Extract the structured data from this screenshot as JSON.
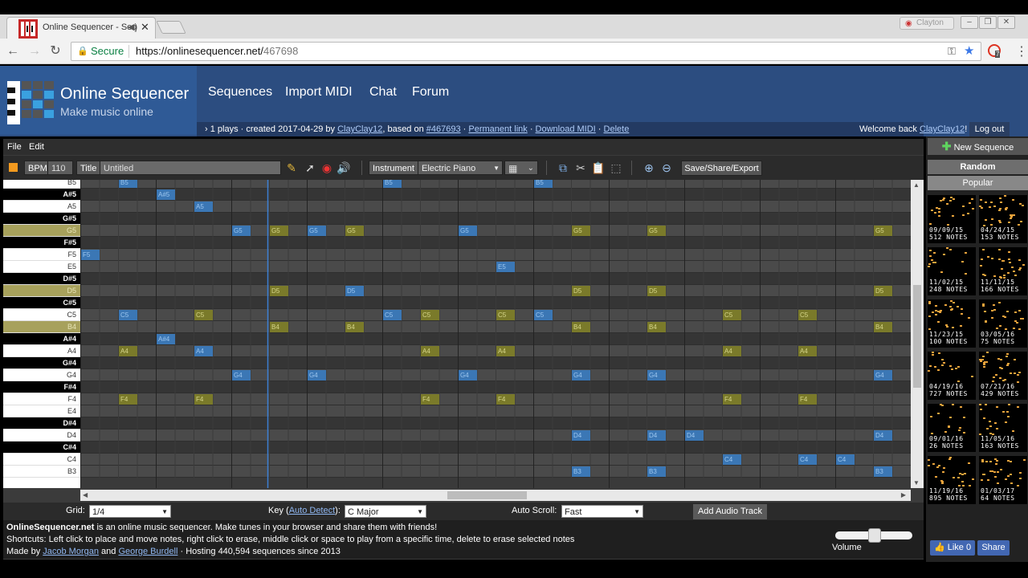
{
  "browser": {
    "tab_title": "Online Sequencer - Seq",
    "user_label": "Clayton",
    "secure_label": "Secure",
    "url_host": "https://onlinesequencer.net/",
    "url_path": "467698",
    "ext_badge": "7"
  },
  "site": {
    "title": "Online Sequencer",
    "subtitle": "Make music online",
    "nav": [
      "Sequences",
      "Import MIDI",
      "Chat",
      "Forum"
    ],
    "info": {
      "prefix": "› 1 plays · created 2017-04-29 by ",
      "author": "ClayClay12",
      "based_on_text": ", based on ",
      "based_on_link": "#467693",
      "sep1": " · ",
      "permanent": "Permanent link",
      "sep2": " · ",
      "download": "Download MIDI",
      "sep3": " · ",
      "delete": "Delete"
    },
    "welcome_text": "Welcome back ",
    "welcome_user": "ClayClay12",
    "welcome_suffix": "!",
    "logout": "Log out"
  },
  "app": {
    "menu": [
      "File",
      "Edit"
    ],
    "bpm_label": "BPM",
    "bpm_value": "110",
    "title_label": "Title",
    "title_value": "Untitled",
    "instrument_label": "Instrument",
    "instrument_value": "Electric Piano",
    "save_button": "Save/Share/Export",
    "colors": {
      "note_blue": "#3b77b5",
      "note_yellow": "#7a7a2a",
      "header_blue": "#2c4d80"
    }
  },
  "piano_keys": [
    {
      "label": "B5",
      "black": false,
      "hl": false
    },
    {
      "label": "A#5",
      "black": true,
      "hl": false
    },
    {
      "label": "A5",
      "black": false,
      "hl": false
    },
    {
      "label": "G#5",
      "black": true,
      "hl": false
    },
    {
      "label": "G5",
      "black": false,
      "hl": true
    },
    {
      "label": "F#5",
      "black": true,
      "hl": false
    },
    {
      "label": "F5",
      "black": false,
      "hl": false
    },
    {
      "label": "E5",
      "black": false,
      "hl": false
    },
    {
      "label": "D#5",
      "black": true,
      "hl": false
    },
    {
      "label": "D5",
      "black": false,
      "hl": true
    },
    {
      "label": "C#5",
      "black": true,
      "hl": false
    },
    {
      "label": "C5",
      "black": false,
      "hl": false
    },
    {
      "label": "B4",
      "black": false,
      "hl": true
    },
    {
      "label": "A#4",
      "black": true,
      "hl": false
    },
    {
      "label": "A4",
      "black": false,
      "hl": false
    },
    {
      "label": "G#4",
      "black": true,
      "hl": false
    },
    {
      "label": "G4",
      "black": false,
      "hl": false
    },
    {
      "label": "F#4",
      "black": true,
      "hl": false
    },
    {
      "label": "F4",
      "black": false,
      "hl": false
    },
    {
      "label": "E4",
      "black": false,
      "hl": false
    },
    {
      "label": "D#4",
      "black": true,
      "hl": false
    },
    {
      "label": "D4",
      "black": false,
      "hl": false
    },
    {
      "label": "C#4",
      "black": true,
      "hl": false
    },
    {
      "label": "C4",
      "black": false,
      "hl": false
    },
    {
      "label": "B3",
      "black": false,
      "hl": false
    }
  ],
  "notes": [
    {
      "n": "B5",
      "s": 2,
      "c": "b"
    },
    {
      "n": "B5",
      "s": 16,
      "c": "b"
    },
    {
      "n": "B5",
      "s": 24,
      "c": "b"
    },
    {
      "n": "A#5",
      "s": 4,
      "c": "b"
    },
    {
      "n": "A5",
      "s": 6,
      "c": "b"
    },
    {
      "n": "G5",
      "s": 8,
      "c": "b"
    },
    {
      "n": "G5",
      "s": 10,
      "c": "y"
    },
    {
      "n": "G5",
      "s": 12,
      "c": "b"
    },
    {
      "n": "G5",
      "s": 14,
      "c": "y"
    },
    {
      "n": "G5",
      "s": 20,
      "c": "b"
    },
    {
      "n": "G5",
      "s": 26,
      "c": "y"
    },
    {
      "n": "G5",
      "s": 30,
      "c": "y"
    },
    {
      "n": "G5",
      "s": 42,
      "c": "y"
    },
    {
      "n": "F5",
      "s": 0,
      "c": "b"
    },
    {
      "n": "E5",
      "s": 22,
      "c": "b"
    },
    {
      "n": "D5",
      "s": 10,
      "c": "y"
    },
    {
      "n": "D5",
      "s": 14,
      "c": "b"
    },
    {
      "n": "D5",
      "s": 26,
      "c": "y"
    },
    {
      "n": "D5",
      "s": 30,
      "c": "y"
    },
    {
      "n": "D5",
      "s": 42,
      "c": "y"
    },
    {
      "n": "C5",
      "s": 2,
      "c": "b"
    },
    {
      "n": "C5",
      "s": 6,
      "c": "y"
    },
    {
      "n": "C5",
      "s": 16,
      "c": "b"
    },
    {
      "n": "C5",
      "s": 18,
      "c": "y"
    },
    {
      "n": "C5",
      "s": 22,
      "c": "y"
    },
    {
      "n": "C5",
      "s": 24,
      "c": "b"
    },
    {
      "n": "C5",
      "s": 34,
      "c": "y"
    },
    {
      "n": "C5",
      "s": 38,
      "c": "y"
    },
    {
      "n": "B4",
      "s": 10,
      "c": "y"
    },
    {
      "n": "B4",
      "s": 14,
      "c": "y"
    },
    {
      "n": "B4",
      "s": 26,
      "c": "y"
    },
    {
      "n": "B4",
      "s": 30,
      "c": "y"
    },
    {
      "n": "B4",
      "s": 42,
      "c": "y"
    },
    {
      "n": "A#4",
      "s": 4,
      "c": "b"
    },
    {
      "n": "A4",
      "s": 2,
      "c": "y"
    },
    {
      "n": "A4",
      "s": 6,
      "c": "b"
    },
    {
      "n": "A4",
      "s": 18,
      "c": "y"
    },
    {
      "n": "A4",
      "s": 22,
      "c": "y"
    },
    {
      "n": "A4",
      "s": 34,
      "c": "y"
    },
    {
      "n": "A4",
      "s": 38,
      "c": "y"
    },
    {
      "n": "G4",
      "s": 8,
      "c": "b"
    },
    {
      "n": "G4",
      "s": 12,
      "c": "b"
    },
    {
      "n": "G4",
      "s": 20,
      "c": "b"
    },
    {
      "n": "G4",
      "s": 26,
      "c": "b"
    },
    {
      "n": "G4",
      "s": 30,
      "c": "b"
    },
    {
      "n": "G4",
      "s": 42,
      "c": "b"
    },
    {
      "n": "F4",
      "s": 2,
      "c": "y"
    },
    {
      "n": "F4",
      "s": 6,
      "c": "y"
    },
    {
      "n": "F4",
      "s": 18,
      "c": "y"
    },
    {
      "n": "F4",
      "s": 22,
      "c": "y"
    },
    {
      "n": "F4",
      "s": 34,
      "c": "y"
    },
    {
      "n": "F4",
      "s": 38,
      "c": "y"
    },
    {
      "n": "D4",
      "s": 26,
      "c": "b"
    },
    {
      "n": "D4",
      "s": 30,
      "c": "b"
    },
    {
      "n": "D4",
      "s": 32,
      "c": "b"
    },
    {
      "n": "D4",
      "s": 42,
      "c": "b"
    },
    {
      "n": "C4",
      "s": 34,
      "c": "b"
    },
    {
      "n": "C4",
      "s": 38,
      "c": "b"
    },
    {
      "n": "C4",
      "s": 40,
      "c": "b"
    },
    {
      "n": "B3",
      "s": 26,
      "c": "b"
    },
    {
      "n": "B3",
      "s": 30,
      "c": "b"
    },
    {
      "n": "B3",
      "s": 42,
      "c": "b"
    }
  ],
  "controls": {
    "grid_label": "Grid:",
    "grid_value": "1/4",
    "key_label": "Key (",
    "key_link": "Auto Detect",
    "key_label_end": "):",
    "key_value": "C Major",
    "autoscroll_label": "Auto Scroll:",
    "autoscroll_value": "Fast",
    "add_audio": "Add Audio Track",
    "volume_label": "Volume",
    "volume_level": 0.5
  },
  "footer": {
    "brand": "OnlineSequencer.net",
    "line1_rest": " is an online music sequencer. Make tunes in your browser and share them with friends!",
    "line2": "Shortcuts: Left click to place and move notes, right click to erase, middle click or space to play from a specific time, delete to erase selected notes",
    "made_by": "Made by ",
    "author1": "Jacob Morgan",
    "and": " and ",
    "author2": "George Burdell",
    "hosting": " · Hosting 440,594 sequences since 2013"
  },
  "sidebar": {
    "new_sequence": "New Sequence",
    "tab_random": "Random",
    "tab_popular": "Popular",
    "thumbs": [
      {
        "date": "09/09/15",
        "notes": "512 NOTES"
      },
      {
        "date": "04/24/15",
        "notes": "153 NOTES"
      },
      {
        "date": "11/02/15",
        "notes": "248 NOTES"
      },
      {
        "date": "11/11/15",
        "notes": "166 NOTES"
      },
      {
        "date": "11/23/15",
        "notes": "100 NOTES"
      },
      {
        "date": "03/05/16",
        "notes": "75 NOTES"
      },
      {
        "date": "04/19/16",
        "notes": "727 NOTES"
      },
      {
        "date": "07/21/16",
        "notes": "429 NOTES"
      },
      {
        "date": "09/01/16",
        "notes": "26 NOTES"
      },
      {
        "date": "11/05/16",
        "notes": "163 NOTES"
      },
      {
        "date": "11/19/16",
        "notes": "895 NOTES"
      },
      {
        "date": "01/03/17",
        "notes": "64 NOTES"
      }
    ],
    "like_label": "Like 0",
    "share_label": "Share"
  }
}
